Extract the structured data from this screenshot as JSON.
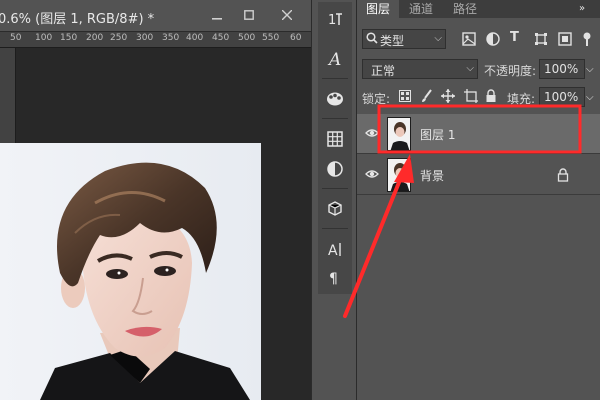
{
  "document": {
    "title": "0.6% (图层 1, RGB/8#) *",
    "window_controls": [
      "minimize-icon",
      "restore-icon",
      "close-icon"
    ],
    "ruler_labels": [
      "50",
      "100",
      "150",
      "200",
      "250",
      "300",
      "350",
      "400",
      "450",
      "500",
      "550",
      "60"
    ]
  },
  "tool_strip": {
    "icons": [
      "history-icon",
      "character-icon",
      "swatches-icon",
      "grid-icon",
      "adjustments-icon",
      "3d-icon",
      "paragraph-text-icon",
      "pilcrow-icon"
    ]
  },
  "layers_panel": {
    "tabs": [
      "图层",
      "通道",
      "路径"
    ],
    "active_tab": "图层",
    "filter": {
      "label": "类型",
      "icon": "search-icon"
    },
    "filter_icons": [
      "pixel-filter-icon",
      "adjustment-filter-icon",
      "text-filter-icon",
      "shape-filter-icon",
      "smart-object-filter-icon",
      "toggle-filter-icon"
    ],
    "blend_mode": "正常",
    "opacity_label": "不透明度:",
    "opacity_value": "100%",
    "lock_label": "锁定:",
    "lock_icons": [
      "lock-transparent-icon",
      "lock-brush-icon",
      "lock-move-icon",
      "lock-artboard-icon",
      "lock-all-icon"
    ],
    "fill_label": "填充:",
    "fill_value": "100%",
    "layers": [
      {
        "name": "图层 1",
        "selected": true,
        "visible": true,
        "locked": false
      },
      {
        "name": "背景",
        "selected": false,
        "visible": true,
        "locked": true
      }
    ]
  },
  "annotation": {
    "highlight_color": "#ff2a2a"
  },
  "colors": {
    "panel_bg": "#535353",
    "selected_layer_bg": "#6a6a6a",
    "canvas_bg": "#282828"
  }
}
